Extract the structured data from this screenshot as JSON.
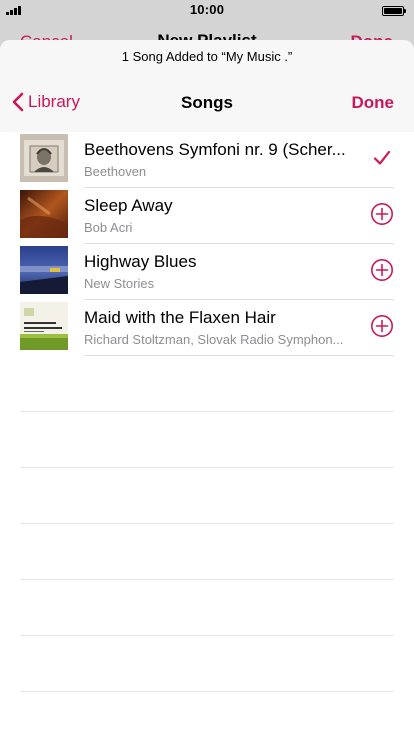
{
  "status_bar": {
    "time": "10:00"
  },
  "underlying_nav": {
    "cancel_label": "Cancel",
    "title": "New Playlist",
    "done_label": "Done"
  },
  "sheet": {
    "banner": "1 Song Added to “My Music .”",
    "back_label": "Library",
    "title": "Songs",
    "done_label": "Done"
  },
  "songs": [
    {
      "title": "Beethovens Symfoni nr. 9 (Scher...",
      "artist": "Beethoven",
      "state": "added",
      "icon": "checkmark-icon"
    },
    {
      "title": "Sleep Away",
      "artist": "Bob Acri",
      "state": "add",
      "icon": "add-circle-icon"
    },
    {
      "title": "Highway Blues",
      "artist": "New Stories",
      "state": "add",
      "icon": "add-circle-icon"
    },
    {
      "title": "Maid with the Flaxen Hair",
      "artist": "Richard Stoltzman, Slovak Radio Symphon...",
      "state": "add",
      "icon": "add-circle-icon"
    }
  ],
  "colors": {
    "accent": "#c9185d",
    "secondary_text": "#8e8e93"
  }
}
